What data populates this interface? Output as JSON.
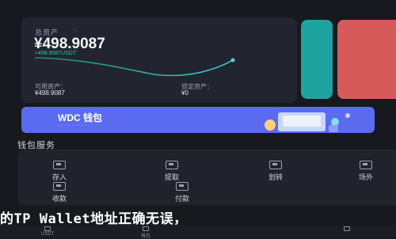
{
  "asset_card": {
    "total_label": "总资产",
    "total_value": "¥498.9087",
    "sub_value": "≈498.9087USDT",
    "available_label": "可用资产：",
    "available_value": "¥498.9087",
    "locked_label": "锁定资产：",
    "locked_value": "¥0",
    "accent_color": "#24c9a0"
  },
  "banner": {
    "title": "WDC 钱包",
    "subtitle": "· · · · · · · · · ·",
    "color": "#5a6bf0"
  },
  "services": {
    "title": "钱包服务",
    "items": [
      {
        "label": "存入",
        "icon": "deposit-icon"
      },
      {
        "label": "提取",
        "icon": "withdraw-icon"
      },
      {
        "label": "划转",
        "icon": "transfer-icon"
      },
      {
        "label": "场外",
        "icon": "otc-icon"
      },
      {
        "label": "收款",
        "icon": "receive-icon"
      },
      {
        "label": "付款",
        "icon": "pay-icon"
      }
    ]
  },
  "caption": "的TP Wallet地址正确无误，",
  "tabbar": {
    "items": [
      {
        "label": "USDT"
      },
      {
        "label": "钱包"
      },
      {
        "label": ""
      }
    ]
  }
}
